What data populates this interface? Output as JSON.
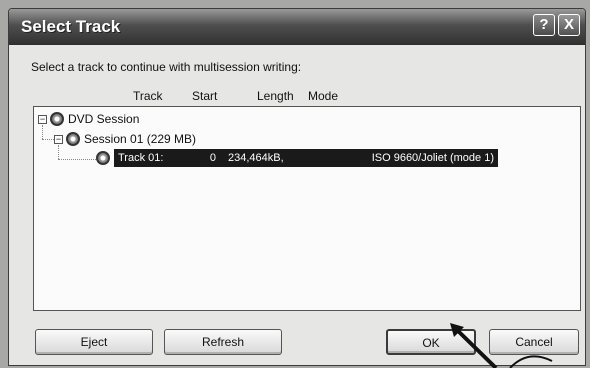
{
  "window": {
    "title": "Select Track"
  },
  "titlebar": {
    "help_label": "?",
    "close_label": "X"
  },
  "prompt": "Select a track to continue with multisession writing:",
  "columns": {
    "track": "Track",
    "start": "Start",
    "length": "Length",
    "mode": "Mode"
  },
  "tree": {
    "root_label": "DVD Session",
    "session_label": "Session 01 (229 MB)",
    "track": {
      "name": "Track 01:",
      "start": "0",
      "length": "234,464kB,",
      "mode": "ISO 9660/Joliet (mode 1)"
    }
  },
  "buttons": {
    "eject": "Eject",
    "refresh": "Refresh",
    "ok": "OK",
    "cancel": "Cancel"
  }
}
